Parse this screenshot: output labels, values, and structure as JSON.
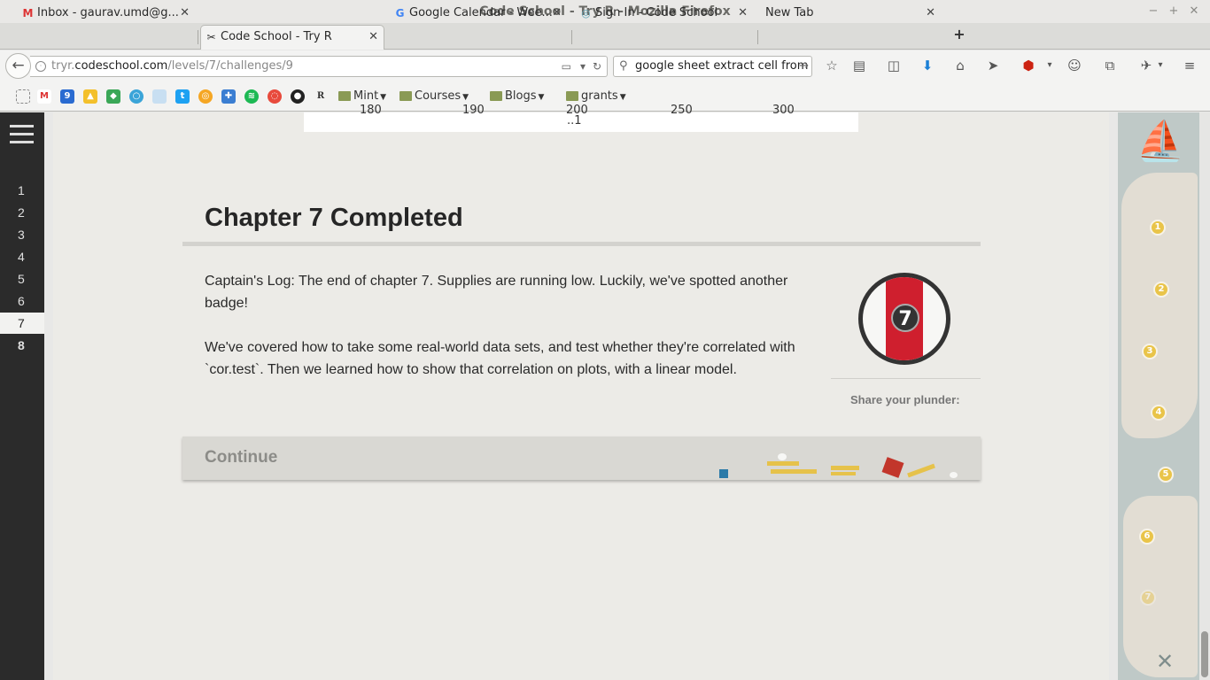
{
  "window": {
    "title": "Code School - Try R - Mozilla Firefox"
  },
  "tabs": [
    {
      "label": "Inbox - gaurav.umd@g...",
      "icon": "gmail-icon"
    },
    {
      "label": "Code School - Try R",
      "icon": "tools-icon",
      "active": true
    },
    {
      "label": "Google Calendar - Wee...",
      "icon": "google-icon"
    },
    {
      "label": "Sign In - Code School",
      "icon": "codeschool-icon"
    },
    {
      "label": "New Tab",
      "icon": ""
    }
  ],
  "nav": {
    "url_prefix": "tryr.",
    "url_domain": "codeschool.com",
    "url_path": "/levels/7/challenges/9",
    "search_value": "google sheet extract cell from"
  },
  "bookmarks": {
    "folders": [
      "Mint",
      "Courses",
      "Blogs",
      "grants"
    ]
  },
  "sidebar": {
    "levels": [
      "1",
      "2",
      "3",
      "4",
      "5",
      "6",
      "7",
      "8"
    ],
    "current": "7"
  },
  "plot_axis": {
    "ticks": [
      "180",
      "190",
      "200",
      "250",
      "300"
    ],
    "cursor_label": "..1"
  },
  "chapter": {
    "title": "Chapter 7 Completed",
    "log": "Captain's Log: The end of chapter 7. Supplies are running low. Luckily, we've spotted another badge!",
    "summary": "We've covered how to take some real-world data sets, and test whether they're correlated with `cor.test`. Then we learned how to show that correlation on plots, with a linear model.",
    "badge_number": "7",
    "share_label": "Share your plunder:",
    "continue_label": "Continue"
  },
  "map": {
    "waypoints": [
      "1",
      "2",
      "3",
      "4",
      "5",
      "6",
      "7"
    ]
  },
  "colors": {
    "badge_red": "#cf1f2e",
    "gold": "#e6c24a",
    "sidebar_dark": "#2b2b2b"
  }
}
